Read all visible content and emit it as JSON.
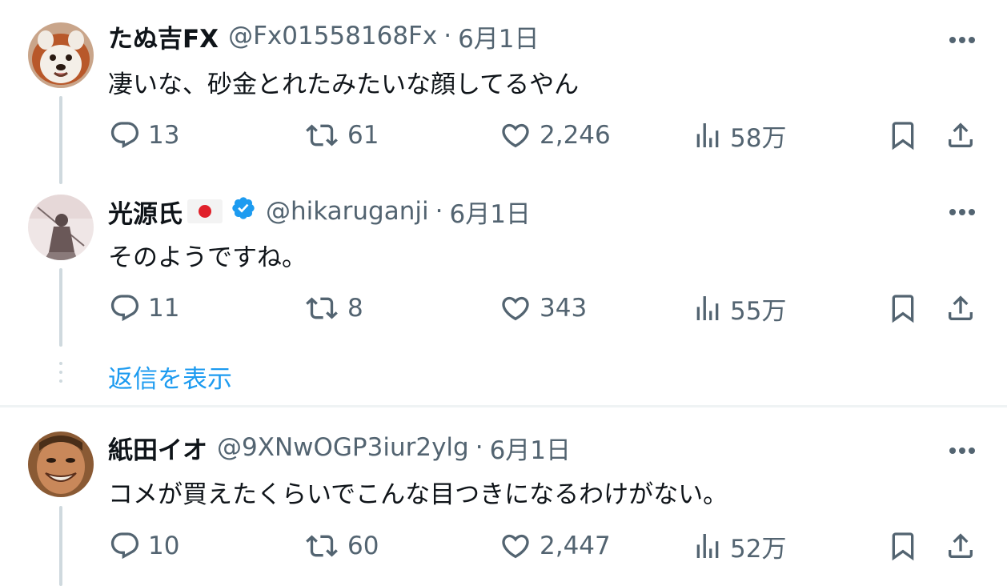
{
  "tweets": [
    {
      "name": "たぬ吉FX",
      "handle": "@Fx01558168Fx",
      "date": "6月1日",
      "text": "凄いな、砂金とれたみたいな顔してるやん",
      "replies": "13",
      "retweets": "61",
      "likes": "2,246",
      "views": "58万"
    },
    {
      "name": "光源氏",
      "handle": "@hikaruganji",
      "date": "6月1日",
      "text": "そのようですね。",
      "replies": "11",
      "retweets": "8",
      "likes": "343",
      "views": "55万"
    },
    {
      "name": "紙田イオ",
      "handle": "@9XNwOGP3iur2ylg",
      "date": "6月1日",
      "text": "コメが買えたくらいでこんな目つきになるわけがない。",
      "replies": "10",
      "retweets": "60",
      "likes": "2,447",
      "views": "52万"
    }
  ],
  "separator": "·",
  "show_replies_label": "返信を表示",
  "colors": {
    "link": "#1d9bf0",
    "muted": "#536471",
    "text": "#0f1419",
    "verified": "#1d9bf0"
  },
  "icons": [
    "reply-icon",
    "retweet-icon",
    "like-icon",
    "views-icon",
    "bookmark-icon",
    "share-icon",
    "more-icon",
    "verified-badge-icon"
  ]
}
